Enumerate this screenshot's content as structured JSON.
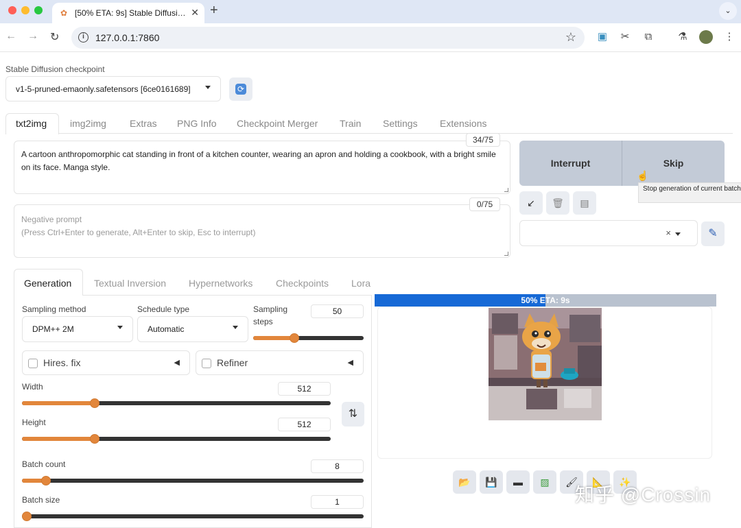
{
  "browser": {
    "tab_title": "[50% ETA: 9s] Stable Diffusi…",
    "url": "127.0.0.1:7860"
  },
  "checkpoint": {
    "label": "Stable Diffusion checkpoint",
    "value": "v1-5-pruned-emaonly.safetensors [6ce0161689]"
  },
  "main_tabs": [
    "txt2img",
    "img2img",
    "Extras",
    "PNG Info",
    "Checkpoint Merger",
    "Train",
    "Settings",
    "Extensions"
  ],
  "prompt": {
    "text": "A cartoon anthropomorphic cat standing in front of a kitchen counter, wearing an apron and holding a cookbook, with a bright smile on its face.  Manga style.",
    "token_count": "34/75"
  },
  "negative_prompt": {
    "placeholder": "Negative prompt\n(Press Ctrl+Enter to generate, Alt+Enter to skip, Esc to interrupt)",
    "token_count": "0/75"
  },
  "actions": {
    "interrupt": "Interrupt",
    "skip": "Skip",
    "skip_tooltip": "Stop generation of current batch"
  },
  "styles": {
    "clear": "×"
  },
  "sub_tabs": [
    "Generation",
    "Textual Inversion",
    "Hypernetworks",
    "Checkpoints",
    "Lora"
  ],
  "generation": {
    "sampling_method": {
      "label": "Sampling method",
      "value": "DPM++ 2M"
    },
    "schedule_type": {
      "label": "Schedule type",
      "value": "Automatic"
    },
    "sampling_steps": {
      "label": "Sampling steps",
      "value": "50",
      "fraction": 0.37
    },
    "hires_fix": {
      "label": "Hires. fix",
      "checked": false
    },
    "refiner": {
      "label": "Refiner",
      "checked": false
    },
    "width": {
      "label": "Width",
      "value": "512",
      "fraction": 0.235
    },
    "height": {
      "label": "Height",
      "value": "512",
      "fraction": 0.235
    },
    "batch_count": {
      "label": "Batch count",
      "value": "8",
      "fraction": 0.07
    },
    "batch_size": {
      "label": "Batch size",
      "value": "1",
      "fraction": 0.0
    }
  },
  "progress": {
    "text": "50% ETA: 9s",
    "fraction": 0.5
  },
  "watermark": "知乎 @Crossin",
  "colors": {
    "accent": "#e2863b",
    "progress": "#1669d6",
    "button_bg": "#c3cbd7"
  }
}
